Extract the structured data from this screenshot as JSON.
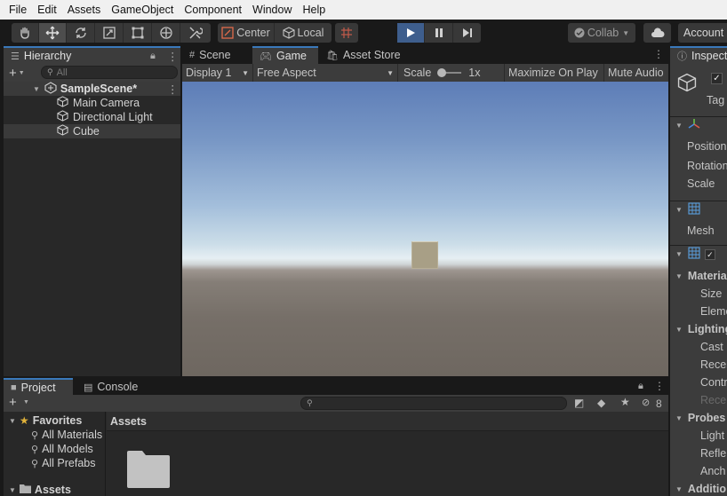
{
  "menu": [
    "File",
    "Edit",
    "Assets",
    "GameObject",
    "Component",
    "Window",
    "Help"
  ],
  "toolbar": {
    "pivot_label": "Center",
    "space_label": "Local",
    "collab_label": "Collab",
    "account_label": "Account"
  },
  "hierarchy": {
    "tab_label": "Hierarchy",
    "search_placeholder": "All",
    "scene_name": "SampleScene*",
    "objects": [
      "Main Camera",
      "Directional Light",
      "Cube"
    ]
  },
  "center_tabs": [
    "Scene",
    "Game",
    "Asset Store"
  ],
  "game": {
    "display": "Display 1",
    "aspect": "Free Aspect",
    "scale_label": "Scale",
    "scale_value": "1x",
    "maximize_label": "Maximize On Play",
    "mute_label": "Mute Audio"
  },
  "inspector": {
    "tab_label": "Inspect",
    "tag_label": "Tag",
    "rows": [
      "Position",
      "Rotation",
      "Scale",
      "Mesh",
      "Materia",
      "Size",
      "Eleme",
      "Lighting",
      "Cast",
      "Recei",
      "Contr",
      "Rece",
      "Probes",
      "Light",
      "Refle",
      "Anch",
      "Additio"
    ]
  },
  "project": {
    "tabs": [
      "Project",
      "Console"
    ],
    "hidden_count": "8",
    "favorites_label": "Favorites",
    "favorites": [
      "All Materials",
      "All Models",
      "All Prefabs"
    ],
    "assets_label": "Assets",
    "assets_header": "Assets"
  }
}
